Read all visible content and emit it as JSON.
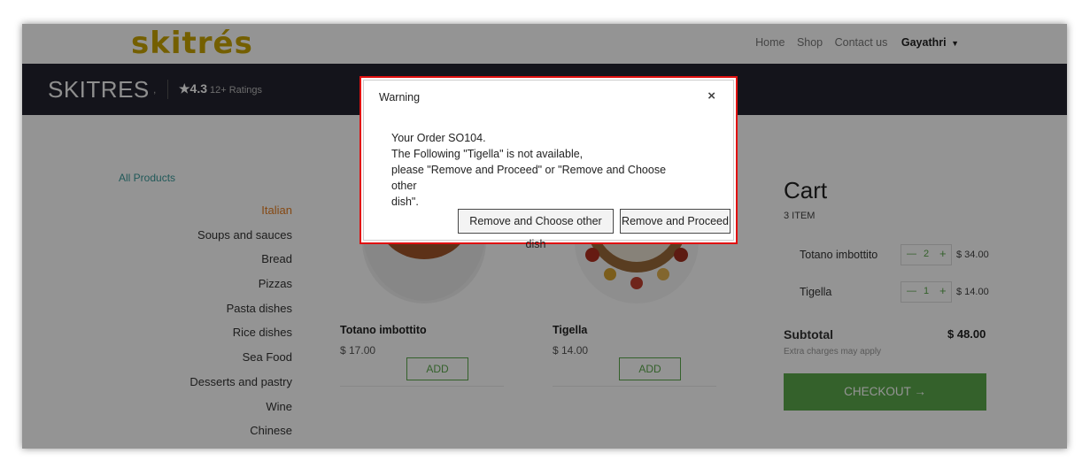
{
  "nav": {
    "logo": "skitrés",
    "links": [
      "Home",
      "Shop",
      "Contact us"
    ],
    "user": "Gayathri"
  },
  "banner": {
    "brand": "SKITRES",
    "separator": ",",
    "rating": "★4.3",
    "ratings_count": "12+ Ratings"
  },
  "sidebar": {
    "all_products": "All Products",
    "categories": [
      "Italian",
      "Soups and sauces",
      "Bread",
      "Pizzas",
      "Pasta dishes",
      "Rice dishes",
      "Sea Food",
      "Desserts and pastry",
      "Wine",
      "Chinese"
    ]
  },
  "products": [
    {
      "name": "Totano imbottito",
      "price": "$ 17.00",
      "add": "ADD"
    },
    {
      "name": "Tigella",
      "price": "$ 14.00",
      "add": "ADD"
    }
  ],
  "cart": {
    "title": "Cart",
    "count": "3 ITEM",
    "items": [
      {
        "name": "Totano imbottito",
        "qty": "2",
        "price": "$ 34.00"
      },
      {
        "name": "Tigella",
        "qty": "1",
        "price": "$ 14.00"
      }
    ],
    "subtotal_label": "Subtotal",
    "subtotal_value": "$ 48.00",
    "extra_note": "Extra charges may apply",
    "checkout": "CHECKOUT →"
  },
  "modal": {
    "title": "Warning",
    "close": "×",
    "line1": "Your Order SO104.",
    "line2": "The Following \"Tigella\" is not available,",
    "line3": "please \"Remove and Proceed\" or \"Remove and Choose other",
    "line4": "dish\".",
    "btn_choose": "Remove and Choose other dish",
    "btn_proceed": "Remove and Proceed"
  },
  "colors": {
    "accent_green": "#5aa84a",
    "banner": "#23232f",
    "active_category": "#e67e22",
    "highlight_border": "#e01010"
  }
}
